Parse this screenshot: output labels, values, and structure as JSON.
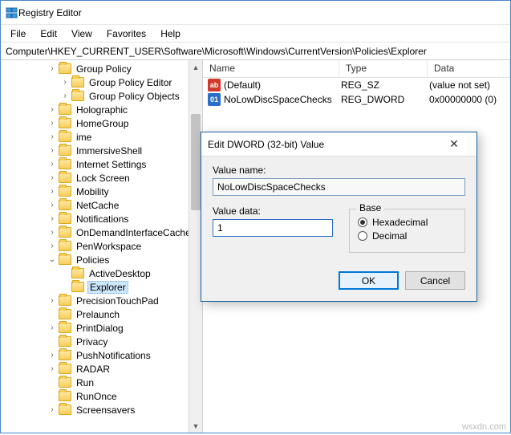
{
  "window": {
    "title": "Registry Editor"
  },
  "menu": {
    "file": "File",
    "edit": "Edit",
    "view": "View",
    "favorites": "Favorites",
    "help": "Help"
  },
  "address": "Computer\\HKEY_CURRENT_USER\\Software\\Microsoft\\Windows\\CurrentVersion\\Policies\\Explorer",
  "tree": {
    "items": [
      {
        "label": "Group Policy",
        "indent": 1,
        "exp": "right"
      },
      {
        "label": "Group Policy Editor",
        "indent": 2,
        "exp": "right"
      },
      {
        "label": "Group Policy Objects",
        "indent": 2,
        "exp": "right"
      },
      {
        "label": "Holographic",
        "indent": 1,
        "exp": "right"
      },
      {
        "label": "HomeGroup",
        "indent": 1,
        "exp": "right"
      },
      {
        "label": "ime",
        "indent": 1,
        "exp": "right"
      },
      {
        "label": "ImmersiveShell",
        "indent": 1,
        "exp": "right"
      },
      {
        "label": "Internet Settings",
        "indent": 1,
        "exp": "right"
      },
      {
        "label": "Lock Screen",
        "indent": 1,
        "exp": "right"
      },
      {
        "label": "Mobility",
        "indent": 1,
        "exp": "right"
      },
      {
        "label": "NetCache",
        "indent": 1,
        "exp": "right"
      },
      {
        "label": "Notifications",
        "indent": 1,
        "exp": "right"
      },
      {
        "label": "OnDemandInterfaceCache",
        "indent": 1,
        "exp": "right"
      },
      {
        "label": "PenWorkspace",
        "indent": 1,
        "exp": "right"
      },
      {
        "label": "Policies",
        "indent": 1,
        "exp": "down"
      },
      {
        "label": "ActiveDesktop",
        "indent": 2,
        "exp": "none"
      },
      {
        "label": "Explorer",
        "indent": 2,
        "exp": "none",
        "selected": true
      },
      {
        "label": "PrecisionTouchPad",
        "indent": 1,
        "exp": "right"
      },
      {
        "label": "Prelaunch",
        "indent": 1,
        "exp": "none"
      },
      {
        "label": "PrintDialog",
        "indent": 1,
        "exp": "right"
      },
      {
        "label": "Privacy",
        "indent": 1,
        "exp": "none"
      },
      {
        "label": "PushNotifications",
        "indent": 1,
        "exp": "right"
      },
      {
        "label": "RADAR",
        "indent": 1,
        "exp": "right"
      },
      {
        "label": "Run",
        "indent": 1,
        "exp": "none"
      },
      {
        "label": "RunOnce",
        "indent": 1,
        "exp": "none"
      },
      {
        "label": "Screensavers",
        "indent": 1,
        "exp": "right"
      }
    ]
  },
  "list": {
    "headers": {
      "name": "Name",
      "type": "Type",
      "data": "Data"
    },
    "rows": [
      {
        "icon": "sz",
        "name": "(Default)",
        "type": "REG_SZ",
        "data": "(value not set)"
      },
      {
        "icon": "dw",
        "name": "NoLowDiscSpaceChecks",
        "type": "REG_DWORD",
        "data": "0x00000000 (0)"
      }
    ]
  },
  "dialog": {
    "title": "Edit DWORD (32-bit) Value",
    "value_name_label": "Value name:",
    "value_name": "NoLowDiscSpaceChecks",
    "value_data_label": "Value data:",
    "value_data": "1",
    "base_label": "Base",
    "hex": "Hexadecimal",
    "dec": "Decimal",
    "ok": "OK",
    "cancel": "Cancel"
  },
  "watermark": "wsxdn.com"
}
